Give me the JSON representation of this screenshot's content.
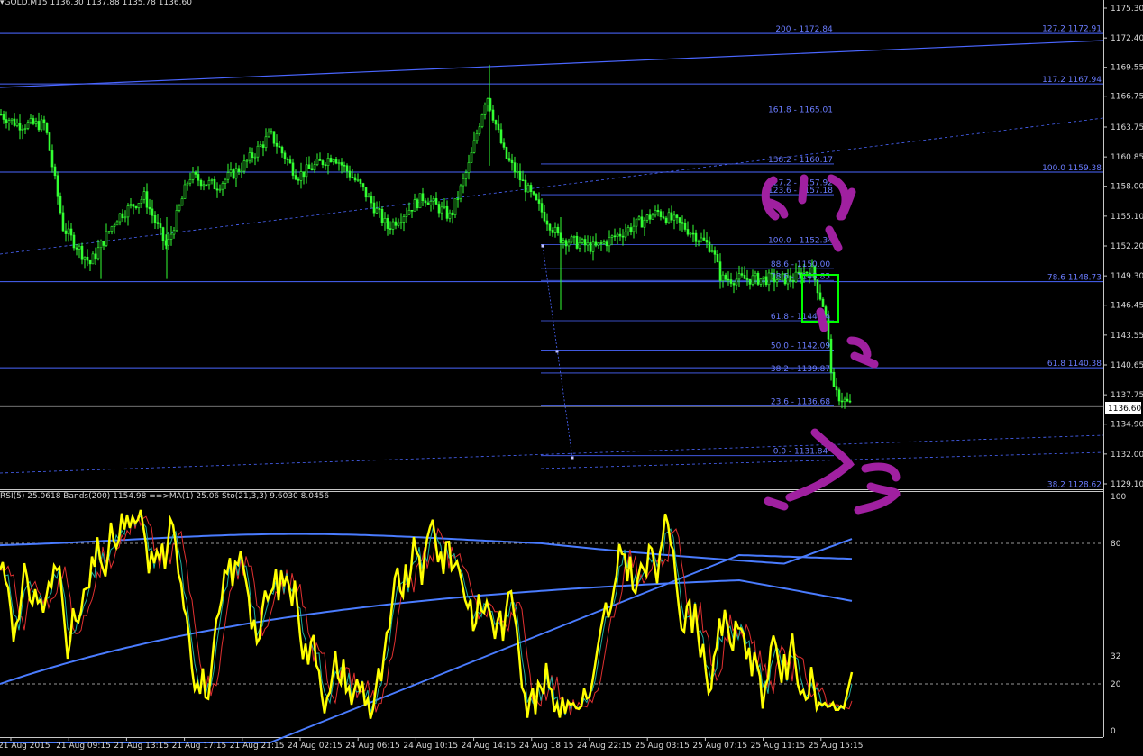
{
  "window": {
    "symbol_header": "GOLD,M15  1136.30 1137.88 1135.78 1136.60"
  },
  "indicator": {
    "header": "RSI(5) 25.0618  Bands(200) 1154.98  ==>MA(1) 25.06  Sto(21,3,3) 9.6030 8.0456"
  },
  "price_axis": {
    "labels": [
      "1175.30",
      "1172.40",
      "1169.55",
      "1166.75",
      "1163.75",
      "1160.85",
      "1158.00",
      "1155.10",
      "1152.20",
      "1149.30",
      "1146.45",
      "1143.55",
      "1140.65",
      "1137.75",
      "1134.90",
      "1132.00",
      "1129.10"
    ],
    "current_price": "1136.60"
  },
  "indicator_axis": {
    "labels": [
      "100",
      "80",
      "32",
      "20",
      "0"
    ]
  },
  "time_axis": {
    "labels": [
      "21 Aug 2015",
      "21 Aug 09:15",
      "21 Aug 13:15",
      "21 Aug 17:15",
      "21 Aug 21:15",
      "24 Aug 02:15",
      "24 Aug 06:15",
      "24 Aug 10:15",
      "24 Aug 14:15",
      "24 Aug 18:15",
      "24 Aug 22:15",
      "25 Aug 03:15",
      "25 Aug 07:15",
      "25 Aug 11:15",
      "25 Aug 15:15"
    ]
  },
  "fib_levels": {
    "level_labels": [
      "200 - 1172.84",
      "161.8 - 1165.01",
      "138.2 - 1160.17",
      "127.2 - 1157.92",
      "123.6 - 1157.18",
      "100.0 - 1152.34",
      "88.6 - 1150.00",
      "78.6 - 1148.85",
      "61.8 - 1144.94",
      "50.0 - 1142.09",
      "38.2 - 1139.87",
      "23.6 - 1136.68",
      "0.0 - 1131.84"
    ],
    "right_labels": [
      "127.2 1172.91",
      "117.2 1167.94",
      "100.0  1159.38",
      "78.6 1148.73",
      "61.8 1140.38",
      "38.2 1128.62"
    ]
  },
  "colors": {
    "background": "#000000",
    "candle": "#33ff33",
    "level_line": "#4a66ff",
    "rsi": "#ffff00",
    "bands": "#4a7cff",
    "stoch_main": "#20b0a0",
    "stoch_signal": "#e03030",
    "annotation": "#a020a0",
    "highlight_box": "#00ff00"
  }
}
